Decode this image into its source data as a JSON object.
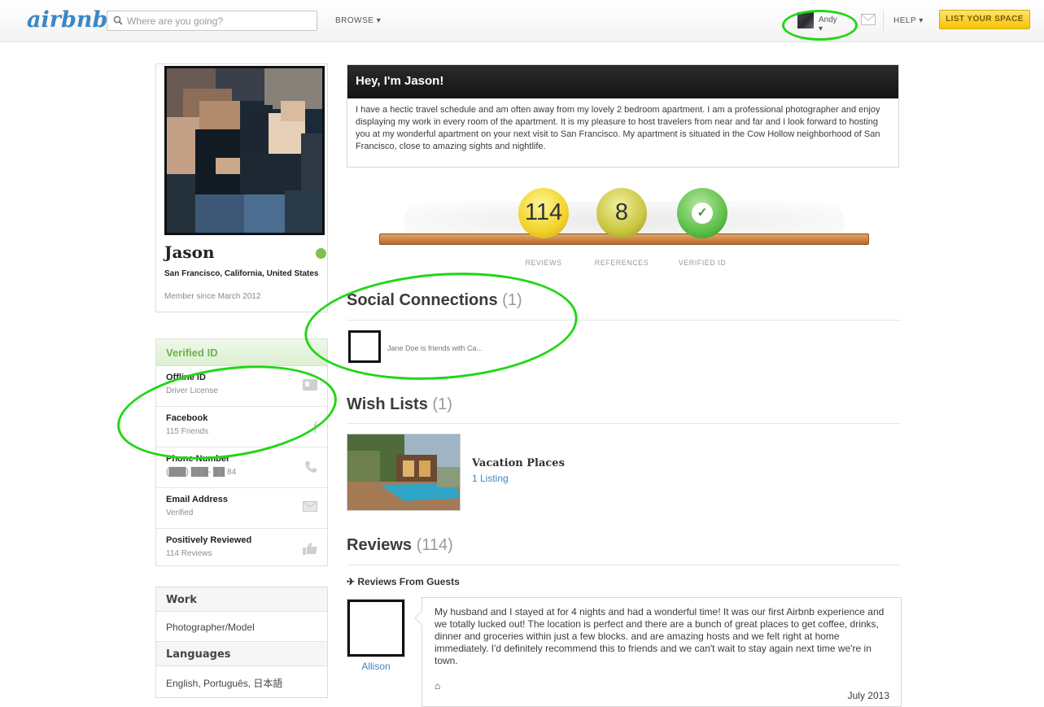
{
  "header": {
    "logo": "airbnb",
    "search_placeholder": "Where are you going?",
    "browse_label": "BROWSE ▾",
    "username": "Andy ▾",
    "help_label": "HELP ▾",
    "list_space_label": "LIST YOUR SPACE"
  },
  "profile": {
    "name": "Jason",
    "location": "San Francisco, California, United States",
    "member_since": "Member since March 2012"
  },
  "verified": {
    "title": "Verified ID",
    "items": [
      {
        "title": "Offline ID",
        "sub": "Driver License",
        "icon": "id-card-icon"
      },
      {
        "title": "Facebook",
        "sub": "115 Friends",
        "icon": "facebook-icon"
      },
      {
        "title": "Phone Number",
        "sub": "(███) ███- ██ 84",
        "icon": "phone-icon"
      },
      {
        "title": "Email Address",
        "sub": "Verified",
        "icon": "envelope-icon"
      },
      {
        "title": "Positively Reviewed",
        "sub": "114 Reviews",
        "icon": "thumbs-up-icon"
      }
    ]
  },
  "work": {
    "work_label": "Work",
    "work_value": "Photographer/Model",
    "languages_label": "Languages",
    "languages_value": "English, Português, 日本語"
  },
  "about": {
    "title": "Hey, I'm Jason!",
    "text": "I have a hectic travel schedule and am often away from my lovely 2 bedroom apartment. I am a professional photographer and enjoy displaying my work in every room of the apartment. It is my pleasure to host travelers from near and far and I look forward to hosting you at my wonderful apartment on your next visit to San Francisco. My apartment is situated in the Cow Hollow neighborhood of San Francisco, close to amazing sights and nightlife."
  },
  "badges": {
    "reviews_value": "114",
    "reviews_label": "REVIEWS",
    "references_value": "8",
    "references_label": "REFERENCES",
    "verified_label": "VERIFIED ID"
  },
  "social": {
    "title": "Social Connections",
    "count": "(1)",
    "text": "Jane Doe is friends with Ca..."
  },
  "wishlists": {
    "title": "Wish Lists",
    "count": "(1)",
    "name": "Vacation Places",
    "listings": "1 Listing"
  },
  "reviews": {
    "title": "Reviews",
    "count": "(114)",
    "subheading": "Reviews From Guests",
    "reviewer": "Allison",
    "text": "My husband and I stayed at                               for 4 nights and had a wonderful time! It was our first Airbnb experience and we totally lucked out! The location is perfect and there are a bunch of great places to get coffee, drinks, dinner and groceries within just a few blocks.                and              are amazing hosts and we felt right at home immediately. I'd definitely recommend this to friends and we can't wait to stay again next time we're in town.",
    "date": "July 2013"
  },
  "colors": {
    "brand": "#3d86c6",
    "verified_green": "#68b54a",
    "annotation_green": "#22d616",
    "cta_yellow": "#f6c400"
  }
}
